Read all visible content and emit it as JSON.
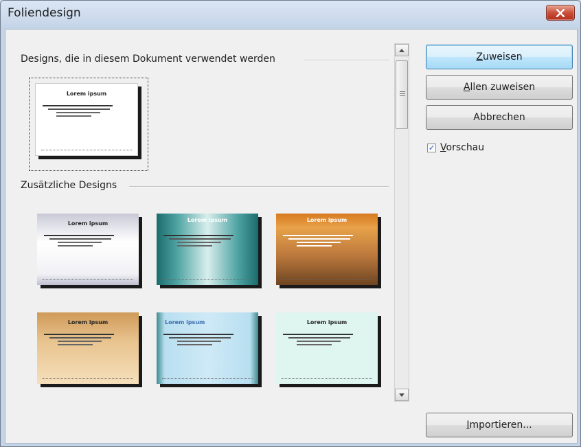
{
  "window": {
    "title": "Foliendesign"
  },
  "groups": {
    "used": "Designs, die in diesem Dokument verwendet werden",
    "additional": "Zusätzliche Designs"
  },
  "slide_text": {
    "title": "Lorem ipsum"
  },
  "designs_used": [
    {
      "name": "default-white"
    }
  ],
  "designs_additional": [
    {
      "name": "grey-gradient"
    },
    {
      "name": "teal-gradient"
    },
    {
      "name": "orange-rounded"
    },
    {
      "name": "tan-gradient"
    },
    {
      "name": "light-blue"
    },
    {
      "name": "mint-yellow"
    }
  ],
  "buttons": {
    "assign": {
      "prefix": "",
      "key": "Z",
      "rest": "uweisen"
    },
    "assign_all": {
      "prefix": "",
      "key": "A",
      "rest": "llen zuweisen"
    },
    "cancel": {
      "label": "Abbrechen"
    },
    "import": {
      "prefix": "",
      "key": "I",
      "rest": "mportieren..."
    }
  },
  "preview": {
    "key": "V",
    "rest": "orschau",
    "checked": true
  },
  "icons": {
    "close": "close-icon",
    "scroll_up": "arrow-up-icon",
    "scroll_down": "arrow-down-icon",
    "check": "checkmark-icon"
  }
}
